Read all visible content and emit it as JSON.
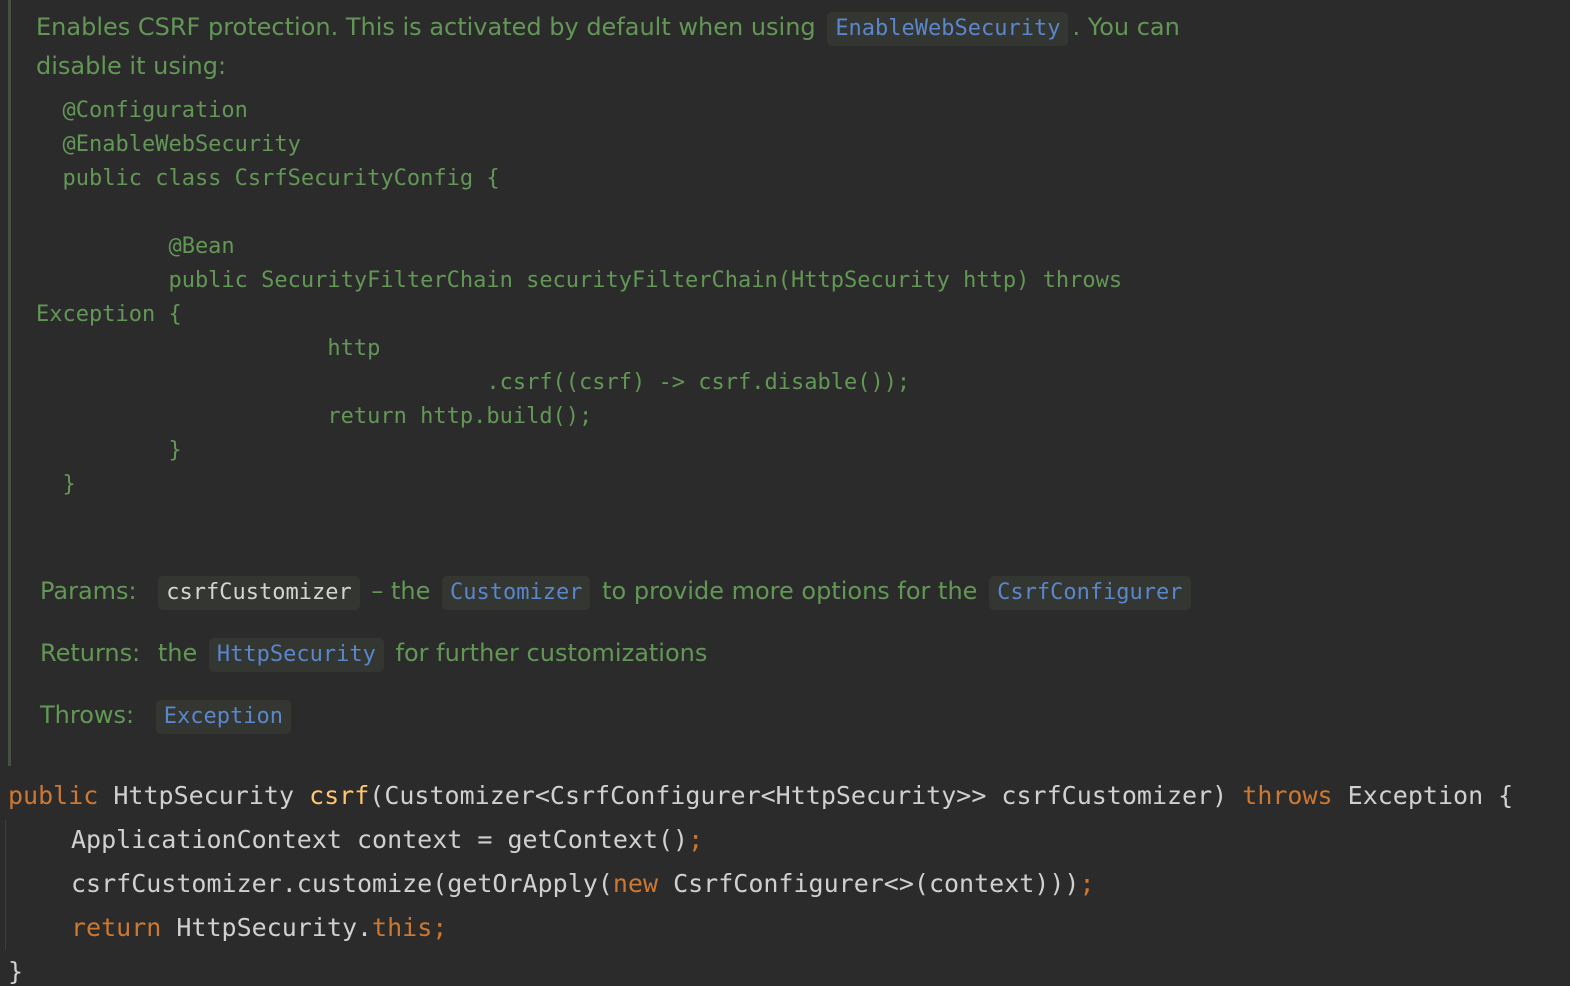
{
  "colors": {
    "background": "#2b2b2b",
    "doc_text": "#629755",
    "doc_link": "#5a86cc",
    "doc_bar": "#465144",
    "keyword": "#cc7832",
    "function_name": "#ffc66d",
    "plain_code": "#d0d0d0"
  },
  "doc": {
    "intro_1": "Enables CSRF protection. This is activated by default when using",
    "intro_link": "EnableWebSecurity",
    "intro_2": ". You can",
    "intro_3": "disable it using:",
    "snippet": [
      "  @Configuration",
      "  @EnableWebSecurity",
      "  public class CsrfSecurityConfig {",
      "",
      "          @Bean",
      "          public SecurityFilterChain securityFilterChain(HttpSecurity http) throws",
      "Exception {",
      "                      http",
      "                                  .csrf((csrf) -> csrf.disable());",
      "                      return http.build();",
      "          }",
      "  }"
    ],
    "params_label": "Params:",
    "params_name": "csrfCustomizer",
    "params_text_1": "– the",
    "params_link_1": "Customizer",
    "params_text_2": "to provide more options for the",
    "params_link_2": "CsrfConfigurer",
    "returns_label": "Returns:",
    "returns_text_1": "the",
    "returns_link": "HttpSecurity",
    "returns_text_2": "for further customizations",
    "throws_label": "Throws:",
    "throws_link": "Exception"
  },
  "code": {
    "line1": {
      "kw_public": "public",
      "type": "HttpSecurity",
      "method": "csrf",
      "params": "(Customizer<CsrfConfigurer<HttpSecurity>> csrfCustomizer)",
      "kw_throws": "throws",
      "rest": "Exception {"
    },
    "line2": {
      "text": "ApplicationContext context = getContext()",
      "semi": ";"
    },
    "line3": {
      "text_1": "csrfCustomizer.customize(getOrApply(",
      "kw_new": "new",
      "text_2": "CsrfConfigurer<>(context))",
      "close": ")",
      "semi": ";"
    },
    "line4": {
      "kw_return": "return",
      "text": "HttpSecurity.",
      "kw_this": "this",
      "semi": ";"
    },
    "line5": {
      "brace": "}"
    }
  }
}
